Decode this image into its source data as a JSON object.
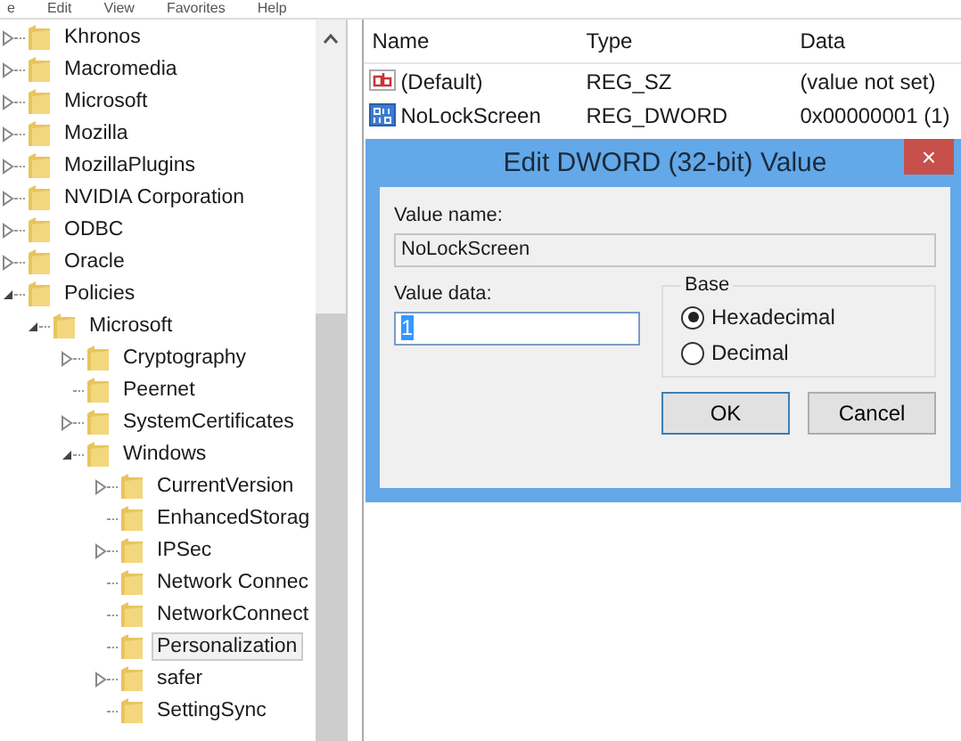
{
  "menu": [
    "e",
    "Edit",
    "View",
    "Favorites",
    "Help"
  ],
  "tree": [
    {
      "label": "Khronos",
      "expanded": false
    },
    {
      "label": "Macromedia",
      "expanded": false
    },
    {
      "label": "Microsoft",
      "expanded": false
    },
    {
      "label": "Mozilla",
      "expanded": false
    },
    {
      "label": "MozillaPlugins",
      "expanded": false
    },
    {
      "label": "NVIDIA Corporation",
      "expanded": false
    },
    {
      "label": "ODBC",
      "expanded": false
    },
    {
      "label": "Oracle",
      "expanded": false
    },
    {
      "label": "Policies",
      "expanded": true,
      "children": [
        {
          "label": "Microsoft",
          "expanded": true,
          "children": [
            {
              "label": "Cryptography",
              "expanded": false
            },
            {
              "label": "Peernet"
            },
            {
              "label": "SystemCertificates",
              "expanded": false
            },
            {
              "label": "Windows",
              "expanded": true,
              "children": [
                {
                  "label": "CurrentVersion",
                  "expanded": false,
                  "selected": false
                },
                {
                  "label": "EnhancedStorag",
                  "selected": false
                },
                {
                  "label": "IPSec",
                  "expanded": false,
                  "selected": false
                },
                {
                  "label": "Network Connec",
                  "selected": false
                },
                {
                  "label": "NetworkConnect",
                  "selected": false
                },
                {
                  "label": "Personalization",
                  "selected": true
                },
                {
                  "label": "safer",
                  "expanded": false,
                  "selected": false
                },
                {
                  "label": "SettingSync",
                  "selected": false
                }
              ]
            }
          ]
        }
      ]
    }
  ],
  "list": {
    "columns": [
      "Name",
      "Type",
      "Data"
    ],
    "rows": [
      {
        "kind": "string",
        "name": "(Default)",
        "type": "REG_SZ",
        "data": "(value not set)"
      },
      {
        "kind": "binary",
        "name": "NoLockScreen",
        "type": "REG_DWORD",
        "data": "0x00000001 (1)"
      }
    ]
  },
  "dialog": {
    "title": "Edit DWORD (32-bit) Value",
    "close": "×",
    "value_name_label": "Value name:",
    "value_name": "NoLockScreen",
    "value_data_label": "Value data:",
    "value_data": "1",
    "base": {
      "label": "Base",
      "options": [
        {
          "label": "Hexadecimal",
          "selected": true
        },
        {
          "label": "Decimal",
          "selected": false
        }
      ]
    },
    "buttons": [
      "OK",
      "Cancel"
    ]
  }
}
